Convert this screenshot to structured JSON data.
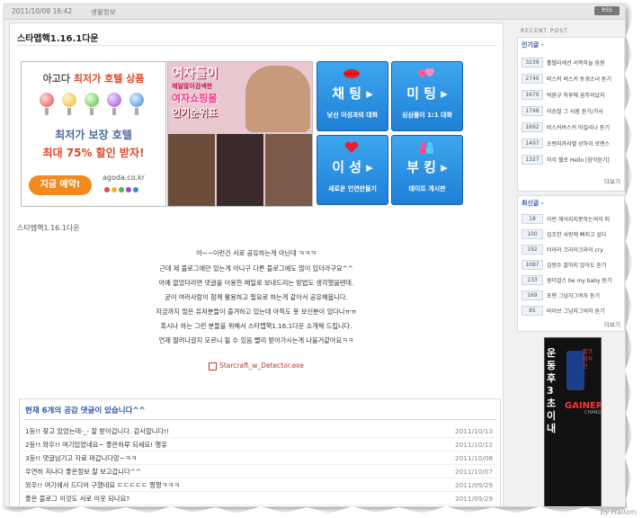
{
  "topbar": {
    "date": "2011/10/08 16:42",
    "category": "생활정보",
    "rss_label": "RSS"
  },
  "post": {
    "title": "스타맵핵1.16.1다운",
    "subtitle": "스타맵핵1.16.1다운"
  },
  "ads": {
    "agoda": {
      "line1_a": "아고다 ",
      "line1_b": "최저가 호텔 상품",
      "line2": "최저가 보장 호텔",
      "line3": "최대 75% 할인 받자!",
      "button": "지금 예약!",
      "brand": "agoda.co.kr"
    },
    "girl": {
      "line1": "여자들이",
      "line2": "제일많이검색한",
      "line3": "여자쇼핑몰",
      "line4": "인기순위표"
    },
    "grid": [
      {
        "big": "채 팅 ▸",
        "small": "낯선 이성과의 대화"
      },
      {
        "big": "미 팅 ▸",
        "small": "심심풀이 1:1 대화"
      },
      {
        "big": "이 성 ▸",
        "small": "새로운 인연만들기"
      },
      {
        "big": "부 킹 ▸",
        "small": "데이트 게시판"
      }
    ]
  },
  "body": [
    "아~~이런건 서로 공유하는게 아닌데 ㅋㅋㅋ",
    "근데 제 블로그에만 있는게 아니구 다른 블로그에도 많이 있더라구요^^",
    "아예 없었더라면 댓글을 이용한 메일로 보내드리는 방법도 생각했을텐데.",
    "굳이 여러사람이 함께 활용하고 필요로 하는게 같아서 공유해봅니다.",
    "지금까지 많은 유저분들이 즐겨하고 있는데 아직도 못 보신분이 있다니ㅠㅠ",
    "혹시나 하는 그런 분들을 위해서 스타맵핵1.16.1다운 소개해 드립니다.",
    "언제 짤려나갈지 모르니 될 수 있음 빨리 받아가시는게 나을거같아요ㅋㅋ"
  ],
  "attachment": "Starcraft_w_Detector.exe",
  "comments": {
    "header": "현재 6개의 공감 댓글이 있습니다^^",
    "rows": [
      {
        "text": "1등!! 찾고 있었는데-_- 잘 받아갑니다. 감사합니다!!",
        "date": "2011/10/13"
      },
      {
        "text": "2등!! 와우!! 여기있었네요~ 좋은하루 되세요! 행유",
        "date": "2011/10/12"
      },
      {
        "text": "3등!! 댓글남기고 자료 퍼갑니다앙~ㅋㅋ",
        "date": "2011/10/08"
      },
      {
        "text": "우연히 지나다 좋은정보 잘 보고갑니다^^",
        "date": "2011/10/07"
      },
      {
        "text": "와우!! 여기에서 드디어 구했네요 ㄷㄷㄷㄷㄷ 짱짱ㅋㅋㅋ",
        "date": "2011/09/29"
      },
      {
        "text": "좋은 블로그 이것도 서로 이웃 되나요?",
        "date": "2011/09/29"
      }
    ]
  },
  "sidebar": {
    "recent_label": "RECENT POST",
    "popular_title": "인기글 -",
    "popular": [
      {
        "num": "3239",
        "label": "홀텔리세션 서쪽하늘 음원"
      },
      {
        "num": "2740",
        "label": "버스커 버스커 동경소녀 듣기"
      },
      {
        "num": "1670",
        "label": "박완규 하루에 꿈주의났지"
      },
      {
        "num": "1746",
        "label": "이승철 그 사람 듣기/가사"
      },
      {
        "num": "1692",
        "label": "버스커버스커 막걸리나 듣기"
      },
      {
        "num": "1497",
        "label": "오렌지카라멜 샹하이 로맨스"
      },
      {
        "num": "1327",
        "label": "허각 헬로 Hello [음악듣기]"
      }
    ],
    "more1": "더보기",
    "latest_title": "최신글 -",
    "latest": [
      {
        "num": "18",
        "label": "이번 헤어지지못하는여자 떠"
      },
      {
        "num": "100",
        "label": "김조한 사랑에 빠지고 싶다"
      },
      {
        "num": "192",
        "label": "티아라 크라이크라이 cry"
      },
      {
        "num": "1087",
        "label": "김범수 말하지 않아도 듣기"
      },
      {
        "num": "133",
        "label": "원더걸스 be my baby 듣기"
      },
      {
        "num": "169",
        "label": "포맨 그남자그여자 듣기"
      },
      {
        "num": "85",
        "label": "바이브 그남자그여자 듣기"
      }
    ],
    "more2": "더보기",
    "side_ad": {
      "v1": "운동후3초이내",
      "v2": "벌크업식신",
      "brand": "GAINERMAX",
      "sub": "CHANGWOOYUNTOOGPROTEIN"
    }
  },
  "watermark": "by Hallom",
  "colors": {
    "accent_blue": "#2b5ba8",
    "button_blue": "#1f7fd6",
    "agoda_orange": "#f28a1e",
    "link_red": "#c0392b"
  }
}
